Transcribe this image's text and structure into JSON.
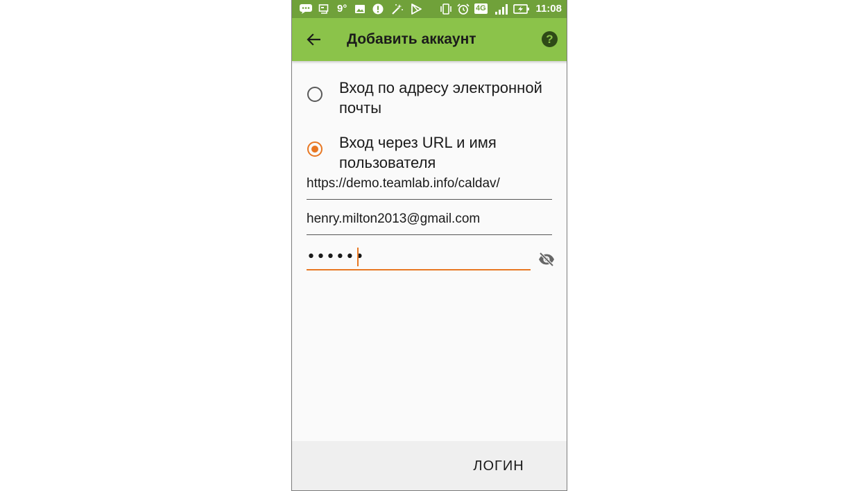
{
  "status_bar": {
    "temperature": "9°",
    "network": "4G",
    "time": "11:08",
    "icons": [
      "chat-icon",
      "cast-icon",
      "temperature-text",
      "image-icon",
      "alert-icon",
      "magic-wand-icon",
      "play-store-icon",
      "vibrate-icon",
      "alarm-icon",
      "network-4g-icon",
      "signal-icon",
      "battery-charging-icon"
    ]
  },
  "toolbar": {
    "title": "Добавить аккаунт",
    "back_icon": "arrow-back-icon",
    "help_label": "?",
    "color": "#8bc34a"
  },
  "login_options": [
    {
      "label": "Вход по адресу электронной почты",
      "selected": false
    },
    {
      "label": "Вход через URL и имя пользователя",
      "selected": true
    }
  ],
  "form": {
    "url_value": "https://demo.teamlab.info/caldav/",
    "username_value": "henry.milton2013@gmail.com",
    "password_mask": "••••••",
    "password_toggle_icon": "eye-off-icon"
  },
  "actions": {
    "login_label": "ЛОГИН"
  },
  "colors": {
    "accent": "#e87722",
    "status_bar": "#70a13a"
  }
}
